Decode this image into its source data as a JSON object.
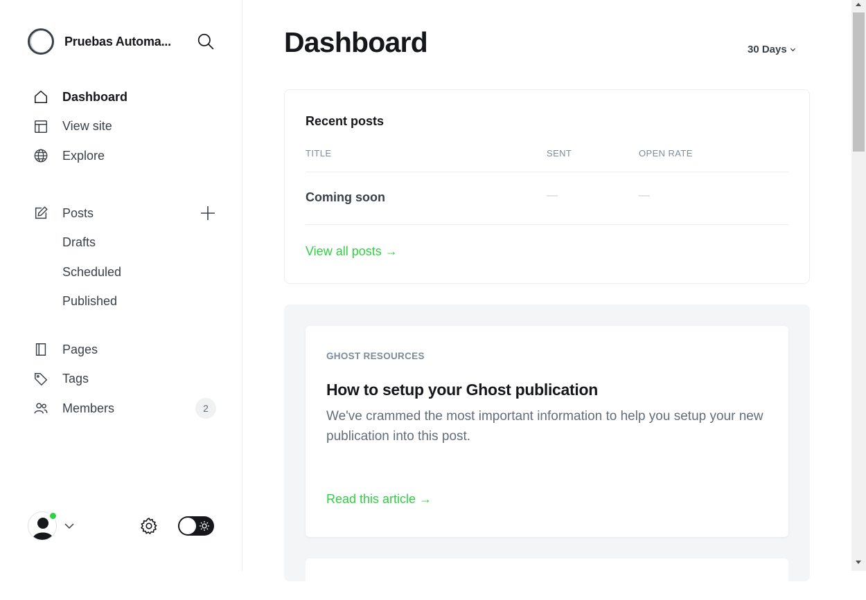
{
  "site": {
    "title": "Pruebas Automa..."
  },
  "nav": {
    "primary": [
      {
        "label": "Dashboard",
        "icon": "home-icon"
      },
      {
        "label": "View site",
        "icon": "layout-icon"
      },
      {
        "label": "Explore",
        "icon": "globe-icon"
      }
    ],
    "posts": {
      "label": "Posts",
      "icon": "edit-icon",
      "sub": [
        "Drafts",
        "Scheduled",
        "Published"
      ]
    },
    "other": [
      {
        "label": "Pages",
        "icon": "page-icon"
      },
      {
        "label": "Tags",
        "icon": "tag-icon"
      },
      {
        "label": "Members",
        "icon": "members-icon",
        "count": "2"
      }
    ]
  },
  "header": {
    "title": "Dashboard",
    "range": "30 Days"
  },
  "recent_posts": {
    "title": "Recent posts",
    "columns": [
      "TITLE",
      "SENT",
      "OPEN RATE"
    ],
    "rows": [
      {
        "title": "Coming soon",
        "sent": "—",
        "open_rate": "—"
      }
    ],
    "view_all": "View all posts →"
  },
  "resources": {
    "label": "GHOST RESOURCES",
    "title": "How to setup your Ghost publication",
    "description": "We've crammed the most important information to help you setup your new publication into this post.",
    "link": "Read this article →"
  },
  "colors": {
    "accent": "#30cf43",
    "text": "#15171a",
    "muted": "#7c8b9a"
  }
}
